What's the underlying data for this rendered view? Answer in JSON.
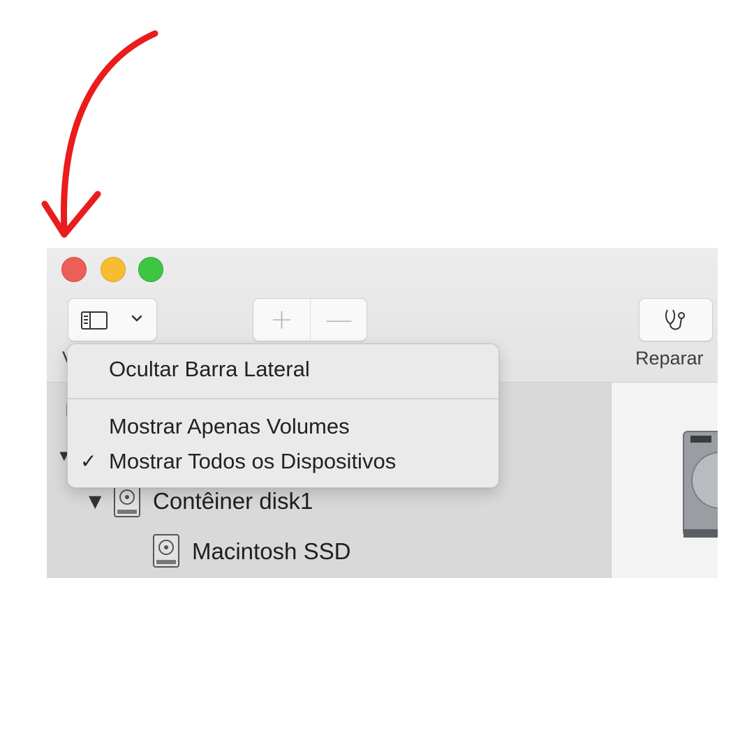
{
  "annotation": {
    "arrow_color": "#ea1c1c",
    "icon": "curved-arrow-icon"
  },
  "window": {
    "traffic_lights": {
      "close_color": "#ec5f57",
      "minimize_color": "#f5bd2f",
      "zoom_color": "#3dc543"
    },
    "toolbar": {
      "view_button": {
        "icon": "sidebar-icon",
        "chevron_icon": "chevron-down-icon"
      },
      "add_symbol": "+",
      "remove_symbol": "—",
      "repair_button": {
        "icon": "stethoscope-icon",
        "label": "Reparar"
      },
      "view_label_peek": "V"
    }
  },
  "sidebar": {
    "peek_row1": "I",
    "peek_row2": "▼",
    "items": [
      {
        "disclosure": "▼",
        "icon": "hard-disk-icon",
        "label": "Contêiner disk1"
      },
      {
        "disclosure": "",
        "icon": "hard-disk-icon",
        "label": "Macintosh SSD"
      }
    ]
  },
  "content": {
    "image": "hard-drive-image"
  },
  "menu": {
    "items": [
      {
        "label": "Ocultar Barra Lateral",
        "checked": false
      },
      {
        "label": "Mostrar Apenas Volumes",
        "checked": false
      },
      {
        "label": "Mostrar Todos os Dispositivos",
        "checked": true,
        "check_mark": "✓"
      }
    ]
  }
}
